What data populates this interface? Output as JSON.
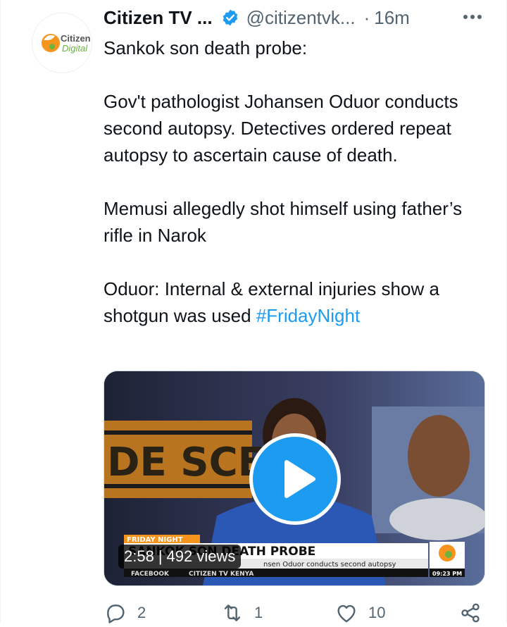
{
  "tweet": {
    "author_name": "Citizen TV ...",
    "handle": "@citizentvk...",
    "separator": "·",
    "time": "16m",
    "text": {
      "line1": "Sankok son death probe:",
      "para2": "Gov't pathologist Johansen Oduor conducts second autopsy. Detectives ordered repeat autopsy to ascertain cause of death.",
      "para3": "Memusi allegedly shot himself using father’s rifle in Narok",
      "para4": "Oduor: Internal & external injuries show a shotgun was used ",
      "hashtag": "#FridayNight"
    },
    "avatar": {
      "brand_line1": "Citizen",
      "brand_line2": "Digital"
    },
    "video": {
      "duration": "2:58",
      "divider": "|",
      "views": "492 views",
      "lower_third": {
        "tag": "FRIDAY NIGHT",
        "headline": "SANKOK SON DEATH PROBE",
        "subtitle": "nsen Oduor conducts second autopsy",
        "ticker_left": "FACEBOOK",
        "ticker_right": "CITIZEN TV KENYA",
        "clock": "09:23 PM"
      },
      "backdrop_text": "DE SCE"
    },
    "actions": {
      "replies": "2",
      "retweets": "1",
      "likes": "10"
    },
    "icons": {
      "verified": "verified-badge-icon",
      "more": "more-horizontal-icon",
      "reply": "reply-icon",
      "retweet": "retweet-icon",
      "like": "heart-icon",
      "share": "share-icon",
      "play": "play-icon"
    },
    "colors": {
      "accent": "#1d9bf0",
      "text": "#0f1419",
      "muted": "#536471",
      "brand_orange": "#f7941d",
      "brand_green": "#6cb33f"
    }
  }
}
